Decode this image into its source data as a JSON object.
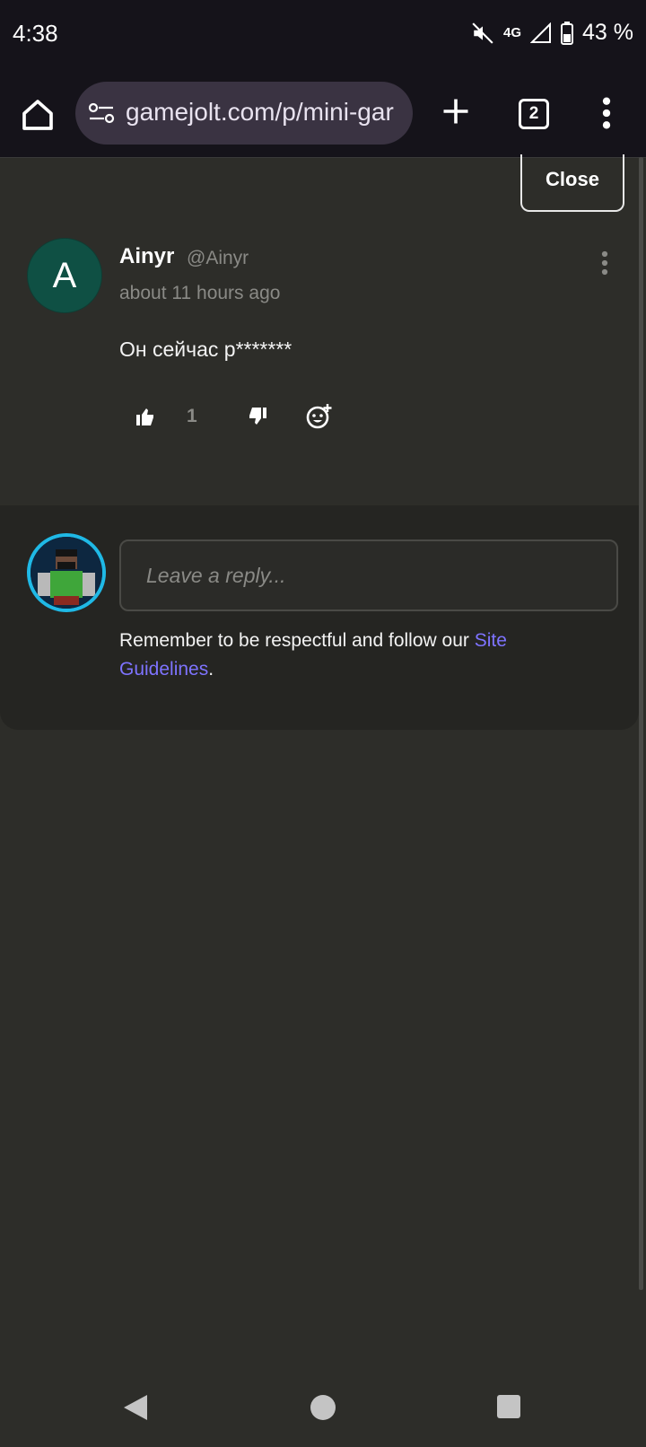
{
  "status": {
    "time": "4:38",
    "network": "4G",
    "battery": "43 %"
  },
  "browser": {
    "url": "gamejolt.com/p/mini-gar",
    "tab_count": "2"
  },
  "dialog": {
    "close_label": "Close"
  },
  "comment": {
    "avatar_letter": "A",
    "author": "Ainyr",
    "handle": "@Ainyr",
    "time": "about 11 hours ago",
    "text": "Он сейчас р*******",
    "likes": "1"
  },
  "reply": {
    "placeholder": "Leave a reply...",
    "guideline_prefix": "Remember to be respectful and follow our ",
    "guideline_link": "Site Guidelines",
    "guideline_suffix": "."
  },
  "colors": {
    "accent": "#7e73ff",
    "avatar_bg": "#0f5044",
    "avatar_ring": "#1fb9e6"
  }
}
